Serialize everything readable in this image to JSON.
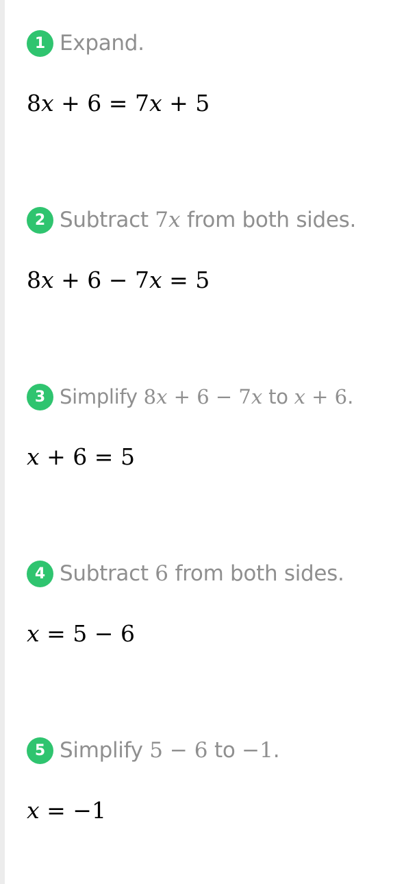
{
  "steps": [
    {
      "number": "1",
      "instruction": [
        "Expand."
      ],
      "equation": "8x + 6 = 7x + 5"
    },
    {
      "number": "2",
      "instruction": [
        "Subtract ",
        "7x",
        " from both sides."
      ],
      "equation": "8x + 6 − 7x = 5"
    },
    {
      "number": "3",
      "instruction": [
        "Simplify ",
        "8x + 6 − 7x",
        " to ",
        "x + 6",
        "."
      ],
      "equation": "x + 6 = 5"
    },
    {
      "number": "4",
      "instruction": [
        "Subtract ",
        "6",
        " from both sides."
      ],
      "equation": "x = 5 − 6"
    },
    {
      "number": "5",
      "instruction": [
        "Simplify ",
        "5 − 6",
        " to ",
        "−1",
        "."
      ],
      "equation": "x = −1"
    }
  ],
  "colors": {
    "badge": "#2fc46f",
    "instruction_text": "#8f8f8f",
    "equation_text": "#000000"
  }
}
